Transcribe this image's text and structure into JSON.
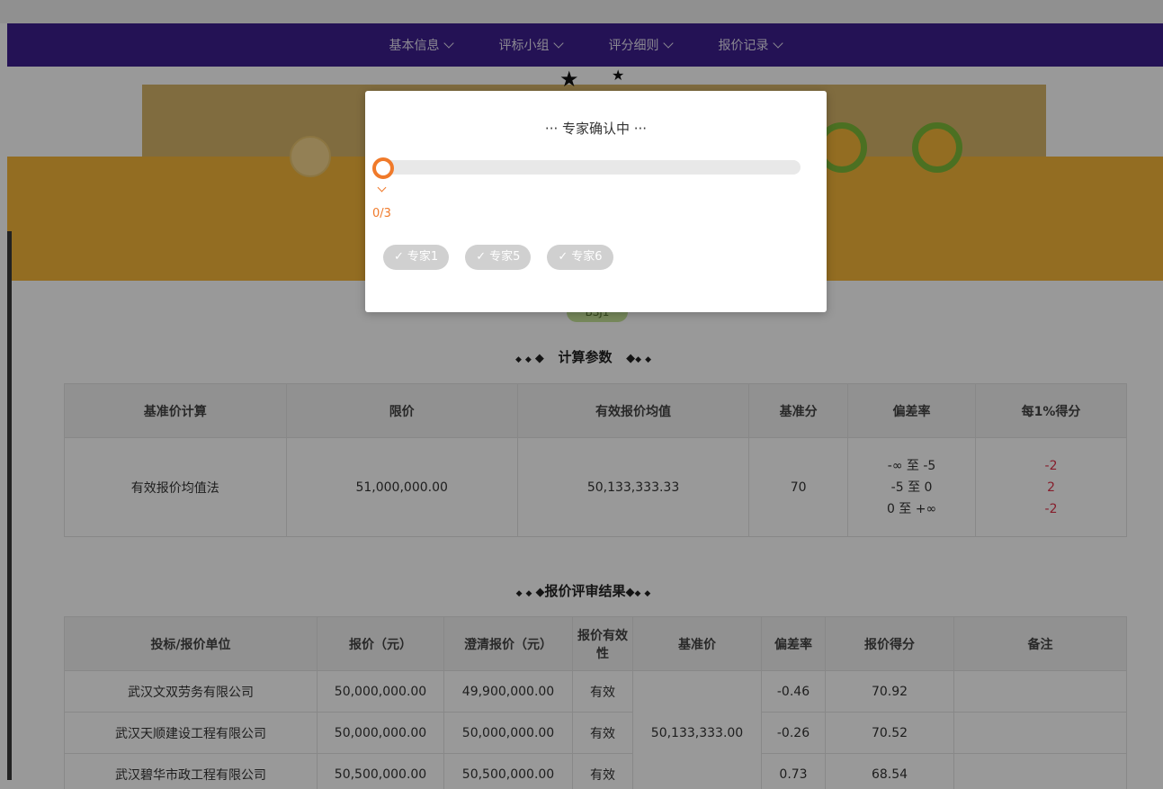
{
  "nav": {
    "items": [
      "基本信息",
      "评标小组",
      "评分细则",
      "报价记录"
    ]
  },
  "badge": "BSJ1",
  "calc_section": {
    "title": "计算参数",
    "headers": [
      "基准价计算",
      "限价",
      "有效报价均值",
      "基准分",
      "偏差率",
      "每1%得分"
    ],
    "row": {
      "method": "有效报价均值法",
      "limit_price": "51,000,000.00",
      "avg_price": "50,133,333.33",
      "base_score": "70",
      "deviation_ranges": [
        "-∞ 至 -5",
        "-5 至 0",
        "0 至 +∞"
      ],
      "scores_per_percent": [
        "-2",
        "2",
        "-2"
      ]
    }
  },
  "result_section": {
    "title": "报价评审结果",
    "headers": [
      "投标/报价单位",
      "报价（元）",
      "澄清报价（元）",
      "报价有效性",
      "基准价",
      "偏差率",
      "报价得分",
      "备注"
    ],
    "base_price": "50,133,333.00",
    "rows": [
      {
        "company": "武汉文双劳务有限公司",
        "price": "50,000,000.00",
        "clarified": "49,900,000.00",
        "validity": "有效",
        "deviation": "-0.46",
        "score": "70.92",
        "note": ""
      },
      {
        "company": "武汉天顺建设工程有限公司",
        "price": "50,000,000.00",
        "clarified": "50,000,000.00",
        "validity": "有效",
        "deviation": "-0.26",
        "score": "70.52",
        "note": ""
      },
      {
        "company": "武汉碧华市政工程有限公司",
        "price": "50,500,000.00",
        "clarified": "50,500,000.00",
        "validity": "有效",
        "deviation": "0.73",
        "score": "68.54",
        "note": ""
      }
    ]
  },
  "modal": {
    "title": "··· 专家确认中 ···",
    "progress_text": "0/3",
    "progress_fraction": 0,
    "experts": [
      "专家1",
      "专家5",
      "专家6"
    ]
  },
  "colors": {
    "nav": "#3d1f8e",
    "accent": "#f07a2a",
    "gold": "#f5b63a",
    "red": "#e0334a"
  }
}
